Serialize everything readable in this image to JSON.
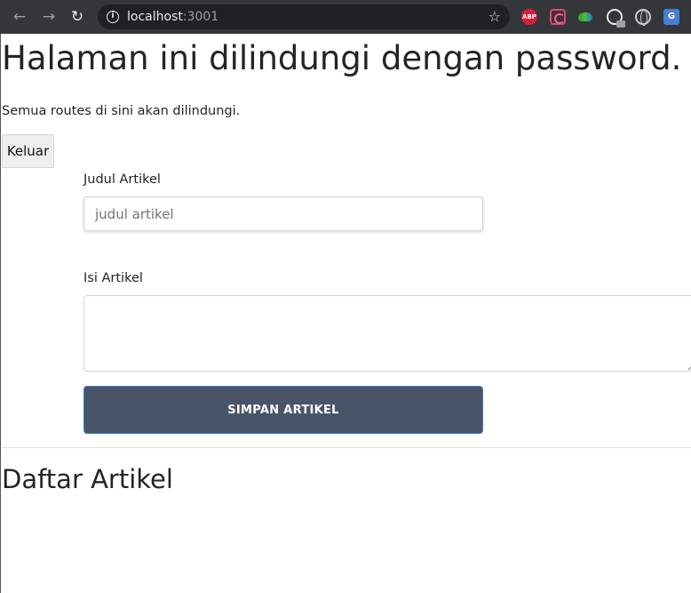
{
  "browser": {
    "url_host": "localhost",
    "url_port": ":3001",
    "icons": {
      "back": "arrow-left-icon",
      "forward": "arrow-right-icon",
      "reload": "reload-icon",
      "info": "info-icon",
      "bookmark": "star-icon"
    },
    "extensions": {
      "abp_label": "ABP",
      "translate_label": "G"
    }
  },
  "page": {
    "title": "Halaman ini dilindungi dengan password.",
    "subtitle": "Semua routes di sini akan dilindungi.",
    "logout_label": "Keluar"
  },
  "form": {
    "title_label": "Judul Artikel",
    "title_placeholder": "judul artikel",
    "title_value": "",
    "content_label": "Isi Artikel",
    "content_value": "",
    "submit_label": "SIMPAN ARTIKEL"
  },
  "articles": {
    "heading": "Daftar Artikel",
    "items": []
  },
  "colors": {
    "chrome_bg": "#35363a",
    "omnibox_bg": "#202124",
    "submit_bg": "#4a5468",
    "submit_border": "#3a7bd5",
    "text": "#212529"
  }
}
